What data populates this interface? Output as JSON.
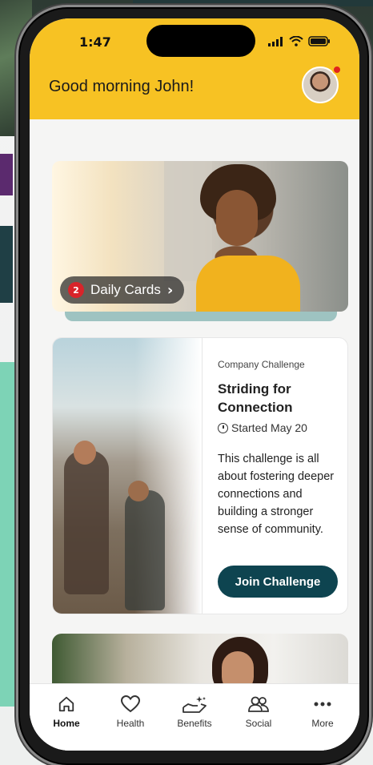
{
  "status_bar": {
    "time": "1:47"
  },
  "header": {
    "greeting": "Good morning John!"
  },
  "daily_cards": {
    "count": "2",
    "label": "Daily Cards"
  },
  "challenge_card": {
    "kicker": "Company Challenge",
    "title": "Striding for Connection",
    "started": "Started May 20",
    "description": "This challenge is all about fostering deeper connections and building a stronger sense of community.",
    "button": "Join Challenge"
  },
  "tabbar": {
    "items": [
      {
        "label": "Home",
        "icon": "home-icon",
        "active": true
      },
      {
        "label": "Health",
        "icon": "heart-icon",
        "active": false
      },
      {
        "label": "Benefits",
        "icon": "benefits-hands-icon",
        "active": false
      },
      {
        "label": "Social",
        "icon": "people-icon",
        "active": false
      },
      {
        "label": "More",
        "icon": "more-dots-icon",
        "active": false
      }
    ]
  },
  "colors": {
    "header_bg": "#f7c223",
    "primary_button": "#0e4450",
    "badge": "#d8242a"
  }
}
